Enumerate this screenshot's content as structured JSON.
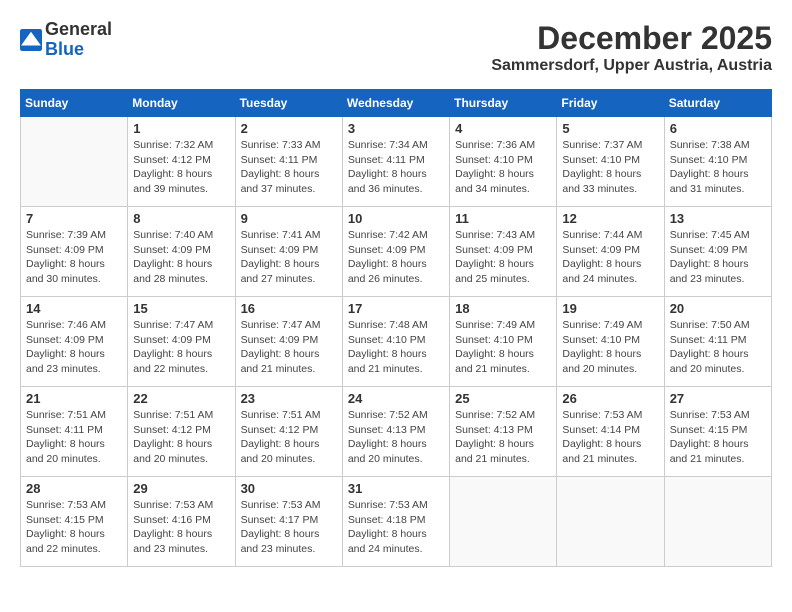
{
  "header": {
    "logo_general": "General",
    "logo_blue": "Blue",
    "month_title": "December 2025",
    "location": "Sammersdorf, Upper Austria, Austria"
  },
  "weekdays": [
    "Sunday",
    "Monday",
    "Tuesday",
    "Wednesday",
    "Thursday",
    "Friday",
    "Saturday"
  ],
  "weeks": [
    [
      {
        "day": "",
        "sunrise": "",
        "sunset": "",
        "daylight": ""
      },
      {
        "day": "1",
        "sunrise": "Sunrise: 7:32 AM",
        "sunset": "Sunset: 4:12 PM",
        "daylight": "Daylight: 8 hours and 39 minutes."
      },
      {
        "day": "2",
        "sunrise": "Sunrise: 7:33 AM",
        "sunset": "Sunset: 4:11 PM",
        "daylight": "Daylight: 8 hours and 37 minutes."
      },
      {
        "day": "3",
        "sunrise": "Sunrise: 7:34 AM",
        "sunset": "Sunset: 4:11 PM",
        "daylight": "Daylight: 8 hours and 36 minutes."
      },
      {
        "day": "4",
        "sunrise": "Sunrise: 7:36 AM",
        "sunset": "Sunset: 4:10 PM",
        "daylight": "Daylight: 8 hours and 34 minutes."
      },
      {
        "day": "5",
        "sunrise": "Sunrise: 7:37 AM",
        "sunset": "Sunset: 4:10 PM",
        "daylight": "Daylight: 8 hours and 33 minutes."
      },
      {
        "day": "6",
        "sunrise": "Sunrise: 7:38 AM",
        "sunset": "Sunset: 4:10 PM",
        "daylight": "Daylight: 8 hours and 31 minutes."
      }
    ],
    [
      {
        "day": "7",
        "sunrise": "Sunrise: 7:39 AM",
        "sunset": "Sunset: 4:09 PM",
        "daylight": "Daylight: 8 hours and 30 minutes."
      },
      {
        "day": "8",
        "sunrise": "Sunrise: 7:40 AM",
        "sunset": "Sunset: 4:09 PM",
        "daylight": "Daylight: 8 hours and 28 minutes."
      },
      {
        "day": "9",
        "sunrise": "Sunrise: 7:41 AM",
        "sunset": "Sunset: 4:09 PM",
        "daylight": "Daylight: 8 hours and 27 minutes."
      },
      {
        "day": "10",
        "sunrise": "Sunrise: 7:42 AM",
        "sunset": "Sunset: 4:09 PM",
        "daylight": "Daylight: 8 hours and 26 minutes."
      },
      {
        "day": "11",
        "sunrise": "Sunrise: 7:43 AM",
        "sunset": "Sunset: 4:09 PM",
        "daylight": "Daylight: 8 hours and 25 minutes."
      },
      {
        "day": "12",
        "sunrise": "Sunrise: 7:44 AM",
        "sunset": "Sunset: 4:09 PM",
        "daylight": "Daylight: 8 hours and 24 minutes."
      },
      {
        "day": "13",
        "sunrise": "Sunrise: 7:45 AM",
        "sunset": "Sunset: 4:09 PM",
        "daylight": "Daylight: 8 hours and 23 minutes."
      }
    ],
    [
      {
        "day": "14",
        "sunrise": "Sunrise: 7:46 AM",
        "sunset": "Sunset: 4:09 PM",
        "daylight": "Daylight: 8 hours and 23 minutes."
      },
      {
        "day": "15",
        "sunrise": "Sunrise: 7:47 AM",
        "sunset": "Sunset: 4:09 PM",
        "daylight": "Daylight: 8 hours and 22 minutes."
      },
      {
        "day": "16",
        "sunrise": "Sunrise: 7:47 AM",
        "sunset": "Sunset: 4:09 PM",
        "daylight": "Daylight: 8 hours and 21 minutes."
      },
      {
        "day": "17",
        "sunrise": "Sunrise: 7:48 AM",
        "sunset": "Sunset: 4:10 PM",
        "daylight": "Daylight: 8 hours and 21 minutes."
      },
      {
        "day": "18",
        "sunrise": "Sunrise: 7:49 AM",
        "sunset": "Sunset: 4:10 PM",
        "daylight": "Daylight: 8 hours and 21 minutes."
      },
      {
        "day": "19",
        "sunrise": "Sunrise: 7:49 AM",
        "sunset": "Sunset: 4:10 PM",
        "daylight": "Daylight: 8 hours and 20 minutes."
      },
      {
        "day": "20",
        "sunrise": "Sunrise: 7:50 AM",
        "sunset": "Sunset: 4:11 PM",
        "daylight": "Daylight: 8 hours and 20 minutes."
      }
    ],
    [
      {
        "day": "21",
        "sunrise": "Sunrise: 7:51 AM",
        "sunset": "Sunset: 4:11 PM",
        "daylight": "Daylight: 8 hours and 20 minutes."
      },
      {
        "day": "22",
        "sunrise": "Sunrise: 7:51 AM",
        "sunset": "Sunset: 4:12 PM",
        "daylight": "Daylight: 8 hours and 20 minutes."
      },
      {
        "day": "23",
        "sunrise": "Sunrise: 7:51 AM",
        "sunset": "Sunset: 4:12 PM",
        "daylight": "Daylight: 8 hours and 20 minutes."
      },
      {
        "day": "24",
        "sunrise": "Sunrise: 7:52 AM",
        "sunset": "Sunset: 4:13 PM",
        "daylight": "Daylight: 8 hours and 20 minutes."
      },
      {
        "day": "25",
        "sunrise": "Sunrise: 7:52 AM",
        "sunset": "Sunset: 4:13 PM",
        "daylight": "Daylight: 8 hours and 21 minutes."
      },
      {
        "day": "26",
        "sunrise": "Sunrise: 7:53 AM",
        "sunset": "Sunset: 4:14 PM",
        "daylight": "Daylight: 8 hours and 21 minutes."
      },
      {
        "day": "27",
        "sunrise": "Sunrise: 7:53 AM",
        "sunset": "Sunset: 4:15 PM",
        "daylight": "Daylight: 8 hours and 21 minutes."
      }
    ],
    [
      {
        "day": "28",
        "sunrise": "Sunrise: 7:53 AM",
        "sunset": "Sunset: 4:15 PM",
        "daylight": "Daylight: 8 hours and 22 minutes."
      },
      {
        "day": "29",
        "sunrise": "Sunrise: 7:53 AM",
        "sunset": "Sunset: 4:16 PM",
        "daylight": "Daylight: 8 hours and 23 minutes."
      },
      {
        "day": "30",
        "sunrise": "Sunrise: 7:53 AM",
        "sunset": "Sunset: 4:17 PM",
        "daylight": "Daylight: 8 hours and 23 minutes."
      },
      {
        "day": "31",
        "sunrise": "Sunrise: 7:53 AM",
        "sunset": "Sunset: 4:18 PM",
        "daylight": "Daylight: 8 hours and 24 minutes."
      },
      {
        "day": "",
        "sunrise": "",
        "sunset": "",
        "daylight": ""
      },
      {
        "day": "",
        "sunrise": "",
        "sunset": "",
        "daylight": ""
      },
      {
        "day": "",
        "sunrise": "",
        "sunset": "",
        "daylight": ""
      }
    ]
  ]
}
